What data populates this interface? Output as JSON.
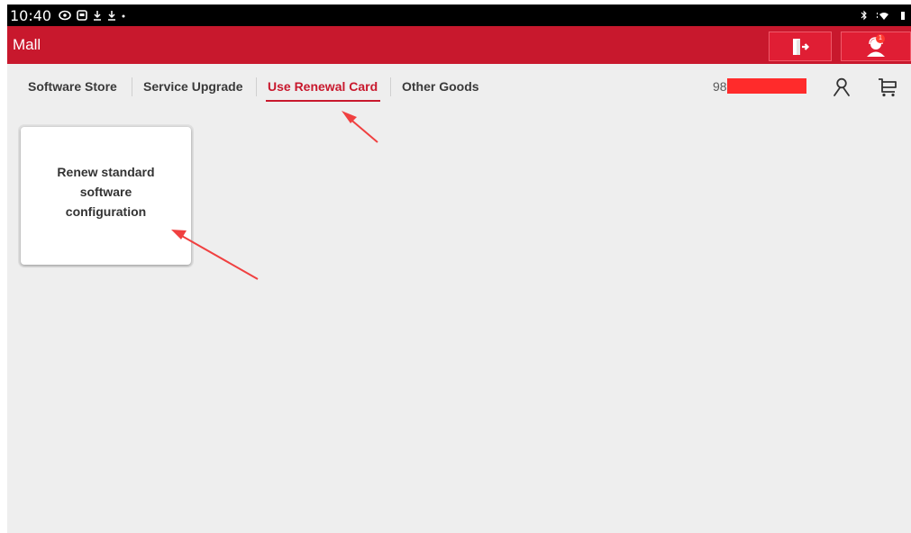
{
  "status_bar": {
    "time": "10:40",
    "left_icons": [
      "eye-icon",
      "screen-icon",
      "download-icon",
      "download-icon",
      "dot-icon"
    ],
    "right_icons": [
      "bluetooth-icon",
      "wifi-icon",
      "battery-icon"
    ]
  },
  "app_bar": {
    "title": "Mall",
    "color": "#c8182d",
    "exit_icon": "exit-icon",
    "user_icon": "user-support-icon",
    "notification_badge": "1"
  },
  "tabs": [
    {
      "label": "Software Store",
      "active": false
    },
    {
      "label": "Service Upgrade",
      "active": false
    },
    {
      "label": "Use Renewal Card",
      "active": true
    },
    {
      "label": "Other Goods",
      "active": false
    }
  ],
  "account": {
    "number_visible": "98",
    "redaction_color": "#ff2b2b"
  },
  "toolbar_icons": {
    "profile": "person-icon",
    "cart": "cart-icon"
  },
  "cards": [
    {
      "label": "Renew standard software configuration"
    }
  ],
  "annotation_color": "#f04040"
}
